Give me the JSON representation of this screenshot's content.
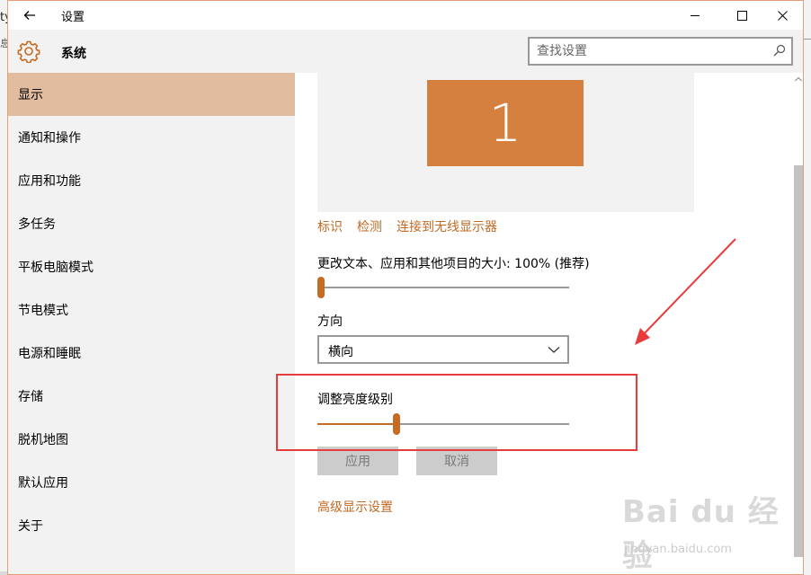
{
  "background": {
    "left_fragment_a": "ty",
    "left_fragment_b": "息"
  },
  "window": {
    "title": "设置",
    "back_icon": "back-arrow-icon",
    "minimize_icon": "minimize-icon",
    "maximize_icon": "maximize-icon",
    "close_icon": "close-icon"
  },
  "header": {
    "icon": "gear-icon",
    "title": "系统",
    "search_placeholder": "查找设置",
    "search_icon": "search-icon"
  },
  "sidebar": {
    "selected_index": 0,
    "items": [
      {
        "label": "显示"
      },
      {
        "label": "通知和操作"
      },
      {
        "label": "应用和功能"
      },
      {
        "label": "多任务"
      },
      {
        "label": "平板电脑模式"
      },
      {
        "label": "节电模式"
      },
      {
        "label": "电源和睡眠"
      },
      {
        "label": "存储"
      },
      {
        "label": "脱机地图"
      },
      {
        "label": "默认应用"
      },
      {
        "label": "关于"
      }
    ]
  },
  "display": {
    "monitor_label": "1",
    "links": [
      "标识",
      "检测",
      "连接到无线显示器"
    ],
    "scale_label": "更改文本、应用和其他项目的大小: 100% (推荐)",
    "scale_value_fraction": 0.0,
    "orientation_label": "方向",
    "orientation_value": "横向",
    "brightness_label": "调整亮度级别",
    "brightness_value_fraction": 0.31,
    "apply_button": "应用",
    "cancel_button": "取消",
    "advanced_link": "高级显示设置"
  },
  "watermark": {
    "logo": "Bai du 经验",
    "url": "jingyan.baidu.com"
  },
  "colors": {
    "accent": "#c66b23",
    "link": "#c06a24",
    "monitor": "#d5803f",
    "selected_nav": "#e2bc9e",
    "annotation": "#e83c3c"
  }
}
